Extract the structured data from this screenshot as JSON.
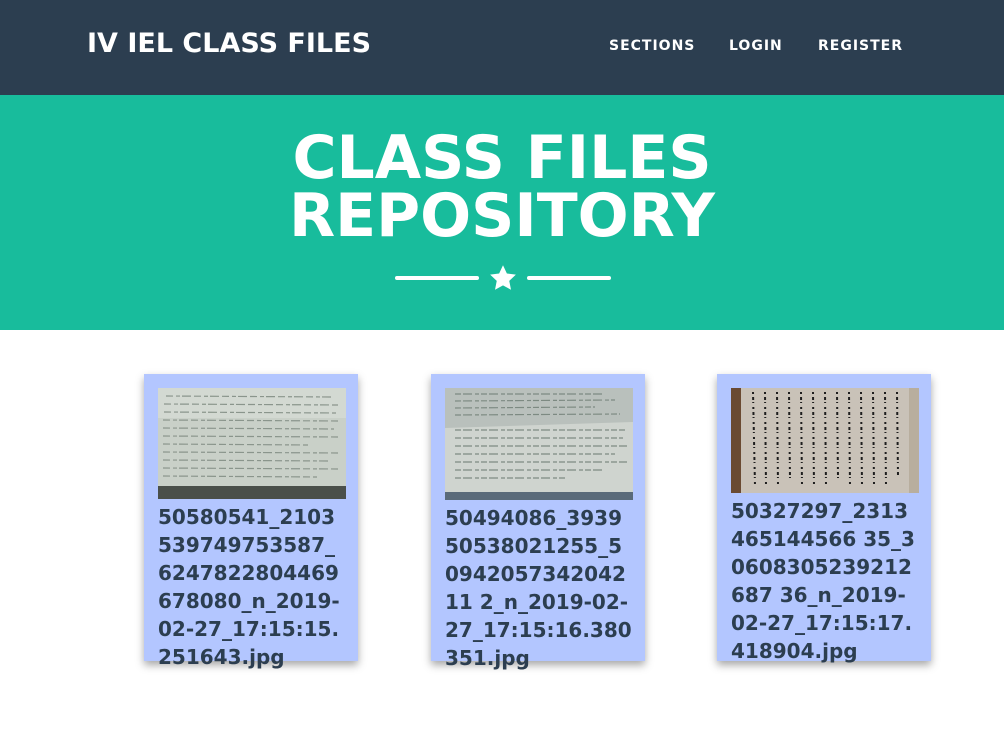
{
  "nav": {
    "brand": "IV IEL CLASS FILES",
    "links": [
      "SECTIONS",
      "LOGIN",
      "REGISTER"
    ]
  },
  "masthead": {
    "title_line1": "CLASS FILES",
    "title_line2": "REPOSITORY",
    "divider_icon": "star-icon"
  },
  "files": [
    {
      "name": "50580541_2103539749753587_6247822804469678080_n_2019-02-27_17:15:15.251643.jpg",
      "thumbnail": "notebook-page-photo"
    },
    {
      "name": "50494086_393950538021255_5094205734204211 2_n_2019-02-27_17:15:16.380351.jpg",
      "thumbnail": "notebook-page-photo"
    },
    {
      "name": "50327297_2313465144566 35_30608305239212687 36_n_2019-02-27_17:15:17.418904.jpg",
      "thumbnail": "printed-sheet-photo"
    }
  ],
  "colors": {
    "navbar": "#2c3e50",
    "masthead": "#18bc9c",
    "card": "#b3c6ff",
    "text": "#2c3e50"
  }
}
